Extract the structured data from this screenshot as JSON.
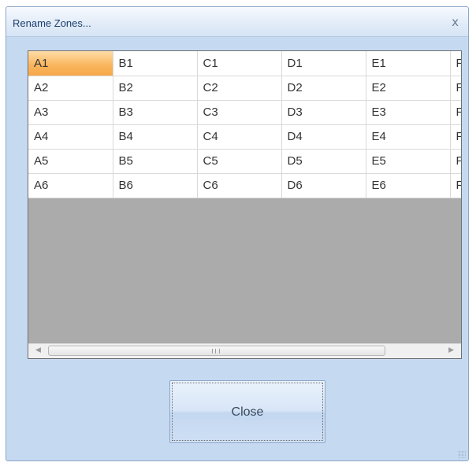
{
  "window": {
    "title": "Rename Zones...",
    "close_glyph": "x"
  },
  "grid": {
    "rows": [
      [
        "A1",
        "B1",
        "C1",
        "D1",
        "E1",
        "F"
      ],
      [
        "A2",
        "B2",
        "C2",
        "D2",
        "E2",
        "F"
      ],
      [
        "A3",
        "B3",
        "C3",
        "D3",
        "E3",
        "F"
      ],
      [
        "A4",
        "B4",
        "C4",
        "D4",
        "E4",
        "F"
      ],
      [
        "A5",
        "B5",
        "C5",
        "D5",
        "E5",
        "F"
      ],
      [
        "A6",
        "B6",
        "C6",
        "D6",
        "E6",
        "F"
      ]
    ],
    "selected_cell": "A1",
    "scroll_left_glyph": "◀",
    "scroll_right_glyph": "▶"
  },
  "buttons": {
    "close_label": "Close"
  },
  "colors": {
    "selected_cell": "#f9b45b",
    "grid_background": "#ababab",
    "dialog_background": "#c5d9f1"
  }
}
